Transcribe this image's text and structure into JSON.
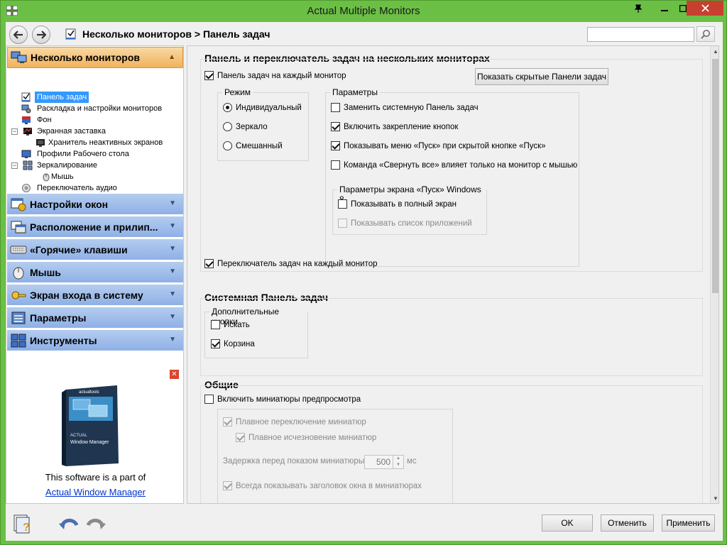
{
  "window": {
    "title": "Actual Multiple Monitors"
  },
  "navbar": {
    "breadcrumb": "Несколько мониторов > Панель задач",
    "search_placeholder": ""
  },
  "sidebar": {
    "sections": [
      {
        "label": "Несколько мониторов",
        "icon": "monitors-icon",
        "expanded": true
      },
      {
        "label": "Настройки окон",
        "icon": "window-settings-icon"
      },
      {
        "label": "Расположение и прилип...",
        "icon": "layout-icon"
      },
      {
        "label": "«Горячие» клавиши",
        "icon": "keyboard-icon"
      },
      {
        "label": "Мышь",
        "icon": "mouse-icon"
      },
      {
        "label": "Экран входа в систему",
        "icon": "key-icon"
      },
      {
        "label": "Параметры",
        "icon": "options-icon"
      },
      {
        "label": "Инструменты",
        "icon": "tools-icon"
      }
    ],
    "tree": [
      {
        "label": "Панель задач",
        "selected": true
      },
      {
        "label": "Раскладка и настройки мониторов"
      },
      {
        "label": "Фон"
      },
      {
        "label": "Экранная заставка"
      },
      {
        "label": "Хранитель неактивных экранов"
      },
      {
        "label": "Профили Рабочего стола"
      },
      {
        "label": "Зеркалирование"
      },
      {
        "label": "Мышь"
      },
      {
        "label": "Переключатель аудио"
      }
    ],
    "promo": {
      "text": "This software is a part of",
      "link": "Actual Window Manager",
      "box_brand": "actualtools",
      "box_title_1": "ACTUAL",
      "box_title_2": "Window Manager"
    }
  },
  "main": {
    "taskbar_section": {
      "title": "Панель и переключатель задач на нескольких мониторах",
      "taskbar_each_monitor": {
        "label": "Панель задач на каждый монитор",
        "checked": true
      },
      "show_hidden_button": "Показать скрытые Панели задач",
      "mode_group": {
        "title": "Режим",
        "options": [
          {
            "label": "Индивидуальный",
            "selected": true
          },
          {
            "label": "Зеркало",
            "selected": false
          },
          {
            "label": "Смешанный",
            "selected": false
          }
        ]
      },
      "params_group": {
        "title": "Параметры",
        "items": [
          {
            "label": "Заменить системную Панель задач",
            "checked": false
          },
          {
            "label": "Включить закрепление кнопок",
            "checked": true
          },
          {
            "label": "Показывать меню «Пуск» при скрытой кнопке «Пуск»",
            "checked": true
          },
          {
            "label": "Команда «Свернуть все» влияет только на монитор с мышью",
            "checked": false
          }
        ],
        "win8_group": {
          "title": "Параметры экрана «Пуск» Windows 8",
          "items": [
            {
              "label": "Показывать в полный экран",
              "checked": false
            },
            {
              "label": "Показывать список приложений",
              "checked": false,
              "disabled": true
            }
          ]
        }
      },
      "switcher_each_monitor": {
        "label": "Переключатель задач на каждый монитор",
        "checked": true
      }
    },
    "system_taskbar_section": {
      "title": "Системная Панель задач",
      "extra_buttons_group": {
        "title": "Дополнительные кнопки",
        "items": [
          {
            "label": "Искать",
            "checked": false
          },
          {
            "label": "Корзина",
            "checked": true
          }
        ]
      }
    },
    "general_section": {
      "title": "Общие",
      "enable_thumbnails": {
        "label": "Включить миниатюры предпросмотра",
        "checked": false
      },
      "smooth_switch": {
        "label": "Плавное переключение миниатюр",
        "checked": true
      },
      "smooth_fade": {
        "label": "Плавное исчезновение миниатюр",
        "checked": true
      },
      "delay_label": "Задержка перед показом миниатюры:",
      "delay_value": "500",
      "delay_unit": "мс",
      "always_show_title": {
        "label": "Всегда показывать заголовок окна в миниатюрах",
        "checked": true
      }
    }
  },
  "footer": {
    "ok": "OK",
    "cancel": "Отменить",
    "apply": "Применить"
  }
}
